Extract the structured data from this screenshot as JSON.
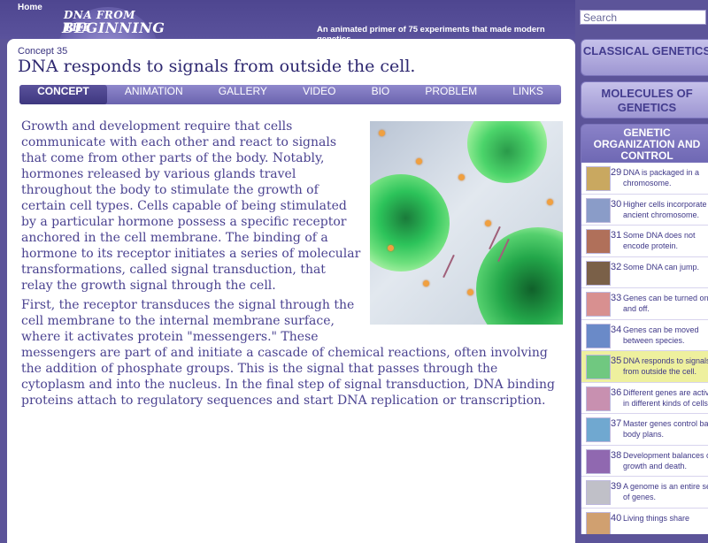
{
  "header": {
    "home_label": "Home",
    "logo_top": "DNA FROM THE",
    "logo_main": "BEGINNING",
    "tagline": "An animated primer of 75 experiments that made modern genetics."
  },
  "search": {
    "placeholder": "Search"
  },
  "page": {
    "concept_label": "Concept 35",
    "title": "DNA responds to signals from outside the cell."
  },
  "tabs": [
    {
      "label": "CONCEPT",
      "active": true
    },
    {
      "label": "ANIMATION"
    },
    {
      "label": "GALLERY"
    },
    {
      "label": "VIDEO"
    },
    {
      "label": "BIO"
    },
    {
      "label": "PROBLEM"
    },
    {
      "label": "LINKS"
    }
  ],
  "body": {
    "paragraph1": "Growth and development require that cells communicate with each other and react to signals that come from other parts of the body. Notably, hormones released by various glands travel throughout the body to stimulate the growth of certain cell types. Cells capable of being stimulated by a particular hormone possess a specific receptor anchored in the cell membrane. The binding of a hormone to its receptor initiates a series of molecular transformations, called signal transduction, that relay the growth signal through the cell.",
    "paragraph2": "First, the receptor transduces the signal through the cell membrane to the internal membrane surface, where it activates protein \"messengers.\" These messengers are part of and initiate a cascade of chemical reactions, often involving the addition of phosphate groups. This is the signal that passes through the cytoplasm and into the nucleus. In the final step of signal transduction, DNA binding proteins attach to regulatory sequences and start DNA replication or transcription."
  },
  "sidebar": {
    "sections": [
      {
        "label": "Classical Genetics"
      },
      {
        "label": "Molecules of Genetics"
      },
      {
        "label": "Genetic Organization and Control",
        "active": true
      }
    ],
    "items": [
      {
        "num": "29",
        "text": "DNA is packaged in a chromosome.",
        "thumb_color": "#c9a860"
      },
      {
        "num": "30",
        "text": "Higher cells incorporate an ancient chromosome.",
        "thumb_color": "#8a9cc8"
      },
      {
        "num": "31",
        "text": "Some DNA does not encode protein.",
        "thumb_color": "#b0705a"
      },
      {
        "num": "32",
        "text": "Some DNA can jump.",
        "thumb_color": "#7a6048"
      },
      {
        "num": "33",
        "text": "Genes can be turned on and off.",
        "thumb_color": "#d89090"
      },
      {
        "num": "34",
        "text": "Genes can be moved between species.",
        "thumb_color": "#6a8ac8"
      },
      {
        "num": "35",
        "text": "DNA responds to signals from outside the cell.",
        "thumb_color": "#70c880",
        "active": true
      },
      {
        "num": "36",
        "text": "Different genes are active in different kinds of cells.",
        "thumb_color": "#c890b0"
      },
      {
        "num": "37",
        "text": "Master genes control basic body plans.",
        "thumb_color": "#70a8d0"
      },
      {
        "num": "38",
        "text": "Development balances cell growth and death.",
        "thumb_color": "#9068b0"
      },
      {
        "num": "39",
        "text": "A genome is an entire set of genes.",
        "thumb_color": "#c0c0c8"
      },
      {
        "num": "40",
        "text": "Living things share",
        "thumb_color": "#d0a070"
      }
    ]
  }
}
